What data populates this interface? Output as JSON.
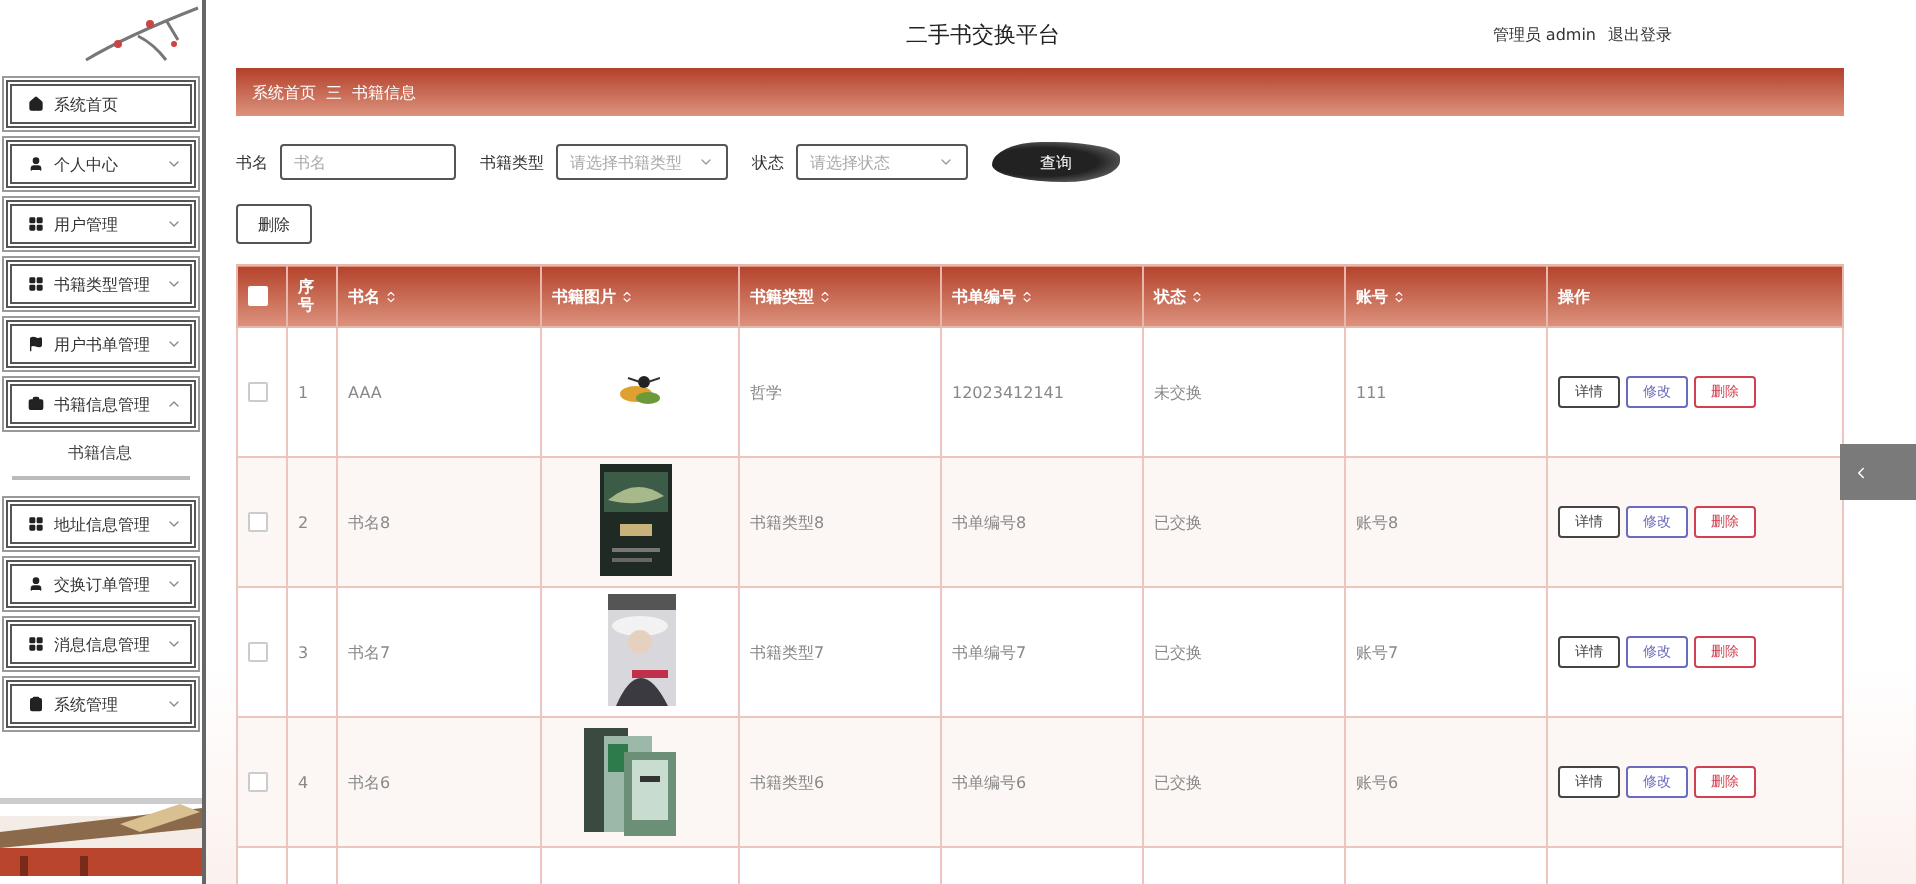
{
  "header": {
    "title": "二手书交换平台",
    "user": "管理员 admin",
    "logout": "退出登录"
  },
  "sidebar": {
    "items": [
      {
        "label": "系统首页",
        "kind": "link"
      },
      {
        "label": "个人中心",
        "kind": "menu",
        "expanded": false
      },
      {
        "label": "用户管理",
        "kind": "menu",
        "expanded": false
      },
      {
        "label": "书籍类型管理",
        "kind": "menu",
        "expanded": false
      },
      {
        "label": "用户书单管理",
        "kind": "menu",
        "expanded": false
      },
      {
        "label": "书籍信息管理",
        "kind": "menu",
        "expanded": true,
        "children": [
          {
            "label": "书籍信息"
          }
        ]
      },
      {
        "label": "地址信息管理",
        "kind": "menu",
        "expanded": false
      },
      {
        "label": "交换订单管理",
        "kind": "menu",
        "expanded": false
      },
      {
        "label": "消息信息管理",
        "kind": "menu",
        "expanded": false
      },
      {
        "label": "系统管理",
        "kind": "menu",
        "expanded": false
      }
    ]
  },
  "breadcrumb": {
    "items": [
      "系统首页",
      "书籍信息"
    ],
    "separator": "三"
  },
  "filters": [
    {
      "label": "书名",
      "kind": "text",
      "placeholder": "书名"
    },
    {
      "label": "书籍类型",
      "kind": "select",
      "placeholder": "请选择书籍类型"
    },
    {
      "label": "状态",
      "kind": "select",
      "placeholder": "请选择状态"
    }
  ],
  "search_button": "查询",
  "delete_button": "删除",
  "table": {
    "select_all": {
      "checked": false
    },
    "columns": [
      {
        "label": "序号",
        "sortable": false
      },
      {
        "label": "书名",
        "sortable": true
      },
      {
        "label": "书籍图片",
        "sortable": true
      },
      {
        "label": "书籍类型",
        "sortable": true
      },
      {
        "label": "书单编号",
        "sortable": true
      },
      {
        "label": "状态",
        "sortable": true
      },
      {
        "label": "账号",
        "sortable": true
      },
      {
        "label": "操作",
        "sortable": false
      }
    ],
    "rows": [
      {
        "checked": false,
        "index": "1",
        "name": "AAA",
        "image": {
          "kind": "picture"
        },
        "type": "哲学",
        "code": "12023412141",
        "status": "未交换",
        "account": "111",
        "actions": [
          {
            "label": "详情",
            "color": "#444444"
          },
          {
            "label": "修改",
            "color": "#6a6ac0"
          },
          {
            "label": "删除",
            "color": "#d04050"
          }
        ]
      },
      {
        "checked": false,
        "index": "2",
        "name": "书名8",
        "image": {
          "kind": "picture"
        },
        "type": "书籍类型8",
        "code": "书单编号8",
        "status": "已交换",
        "account": "账号8",
        "actions": [
          {
            "label": "详情",
            "color": "#444444"
          },
          {
            "label": "修改",
            "color": "#6a6ac0"
          },
          {
            "label": "删除",
            "color": "#d04050"
          }
        ]
      },
      {
        "checked": false,
        "index": "3",
        "name": "书名7",
        "image": {
          "kind": "picture"
        },
        "type": "书籍类型7",
        "code": "书单编号7",
        "status": "已交换",
        "account": "账号7",
        "actions": [
          {
            "label": "详情",
            "color": "#444444"
          },
          {
            "label": "修改",
            "color": "#6a6ac0"
          },
          {
            "label": "删除",
            "color": "#d04050"
          }
        ]
      },
      {
        "checked": false,
        "index": "4",
        "name": "书名6",
        "image": {
          "kind": "picture"
        },
        "type": "书籍类型6",
        "code": "书单编号6",
        "status": "已交换",
        "account": "账号6",
        "actions": [
          {
            "label": "详情",
            "color": "#444444"
          },
          {
            "label": "修改",
            "color": "#6a6ac0"
          },
          {
            "label": "删除",
            "color": "#d04050"
          }
        ]
      }
    ]
  }
}
